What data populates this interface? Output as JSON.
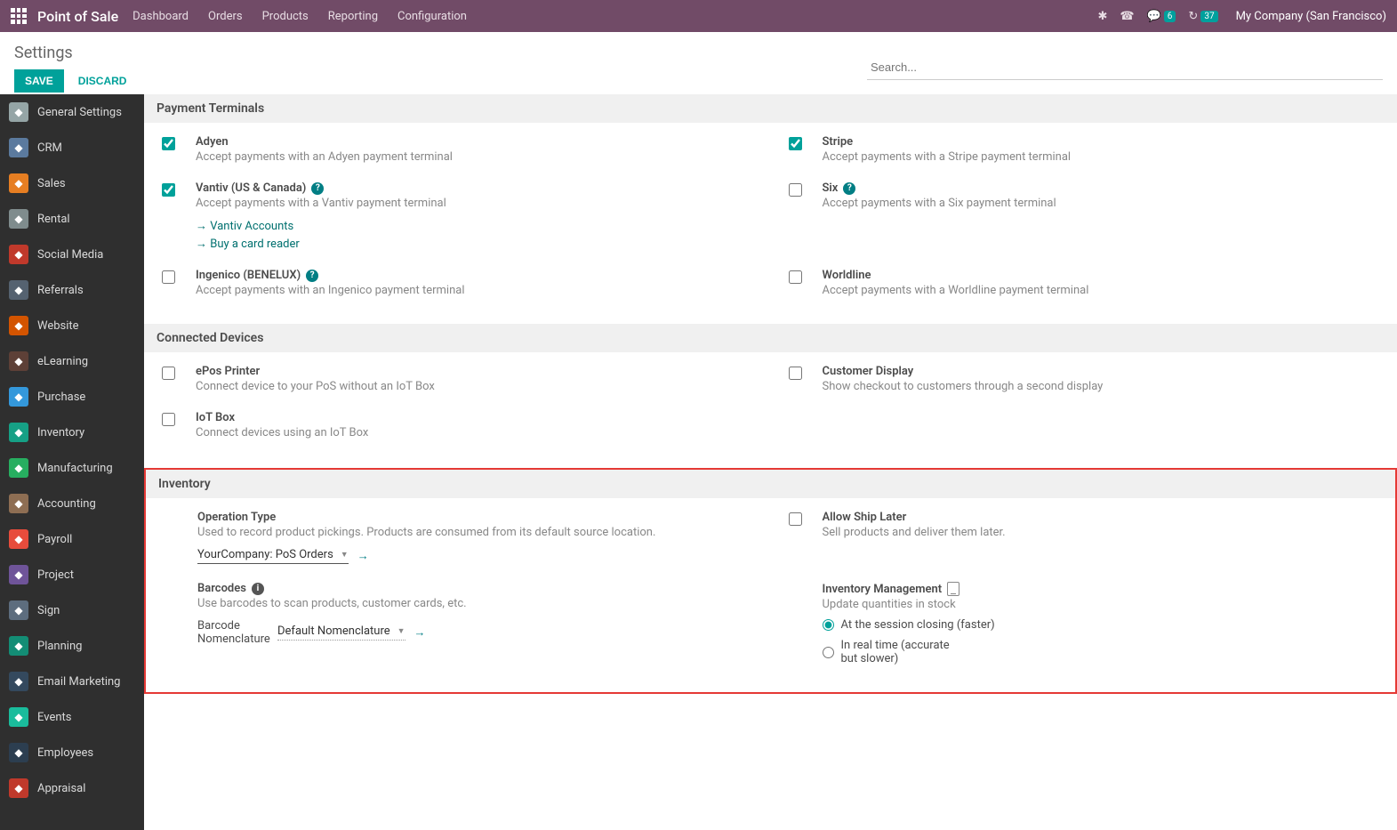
{
  "nav": {
    "brand": "Point of Sale",
    "menu": [
      "Dashboard",
      "Orders",
      "Products",
      "Reporting",
      "Configuration"
    ],
    "msg_badge": "6",
    "clock_badge": "37",
    "company": "My Company (San Francisco)"
  },
  "control": {
    "title": "Settings",
    "save": "SAVE",
    "discard": "DISCARD",
    "search_placeholder": "Search..."
  },
  "sidebar": [
    {
      "label": "General Settings",
      "color": "#95a5a6"
    },
    {
      "label": "CRM",
      "color": "#5b7a9e"
    },
    {
      "label": "Sales",
      "color": "#e67e22"
    },
    {
      "label": "Rental",
      "color": "#7f8c8d"
    },
    {
      "label": "Social Media",
      "color": "#c0392b"
    },
    {
      "label": "Referrals",
      "color": "#556270"
    },
    {
      "label": "Website",
      "color": "#d35400"
    },
    {
      "label": "eLearning",
      "color": "#5d4037"
    },
    {
      "label": "Purchase",
      "color": "#3498db"
    },
    {
      "label": "Inventory",
      "color": "#16a085"
    },
    {
      "label": "Manufacturing",
      "color": "#27ae60"
    },
    {
      "label": "Accounting",
      "color": "#8e6e53"
    },
    {
      "label": "Payroll",
      "color": "#e74c3c"
    },
    {
      "label": "Project",
      "color": "#6f5499"
    },
    {
      "label": "Sign",
      "color": "#5d6d7e"
    },
    {
      "label": "Planning",
      "color": "#138d75"
    },
    {
      "label": "Email Marketing",
      "color": "#34495e"
    },
    {
      "label": "Events",
      "color": "#1abc9c"
    },
    {
      "label": "Employees",
      "color": "#2c3e50"
    },
    {
      "label": "Appraisal",
      "color": "#c0392b"
    }
  ],
  "sections": {
    "payment_terminals": {
      "title": "Payment Terminals",
      "adyen": {
        "label": "Adyen",
        "desc": "Accept payments with an Adyen payment terminal"
      },
      "stripe": {
        "label": "Stripe",
        "desc": "Accept payments with a Stripe payment terminal"
      },
      "vantiv": {
        "label": "Vantiv (US & Canada)",
        "desc": "Accept payments with a Vantiv payment terminal",
        "link1": "Vantiv Accounts",
        "link2": "Buy a card reader"
      },
      "six": {
        "label": "Six",
        "desc": "Accept payments with a Six payment terminal"
      },
      "ingenico": {
        "label": "Ingenico (BENELUX)",
        "desc": "Accept payments with an Ingenico payment terminal"
      },
      "worldline": {
        "label": "Worldline",
        "desc": "Accept payments with a Worldline payment terminal"
      }
    },
    "connected_devices": {
      "title": "Connected Devices",
      "epos": {
        "label": "ePos Printer",
        "desc": "Connect device to your PoS without an IoT Box"
      },
      "customer_display": {
        "label": "Customer Display",
        "desc": "Show checkout to customers through a second display"
      },
      "iot_box": {
        "label": "IoT Box",
        "desc": "Connect devices using an IoT Box"
      }
    },
    "inventory": {
      "title": "Inventory",
      "operation_type": {
        "label": "Operation Type",
        "desc": "Used to record product pickings. Products are consumed from its default source location.",
        "value": "YourCompany: PoS Orders"
      },
      "ship_later": {
        "label": "Allow Ship Later",
        "desc": "Sell products and deliver them later."
      },
      "barcodes": {
        "label": "Barcodes",
        "desc": "Use barcodes to scan products, customer cards, etc.",
        "field_label": "Barcode Nomenclature",
        "value": "Default Nomenclature"
      },
      "inv_mgmt": {
        "label": "Inventory Management",
        "desc": "Update quantities in stock",
        "opt1": "At the session closing (faster)",
        "opt2": "In real time (accurate but slower)"
      }
    }
  }
}
